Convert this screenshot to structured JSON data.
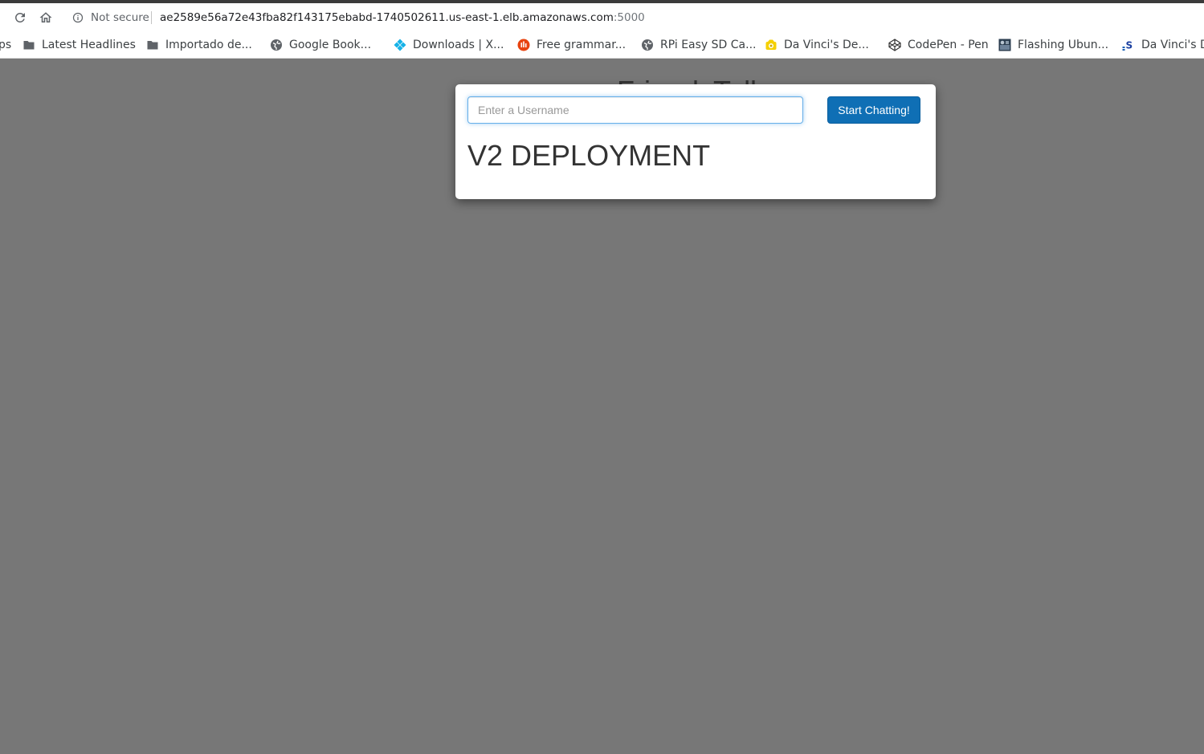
{
  "browser": {
    "security_label": "Not secure",
    "url_host": "ae2589e56a72e43fba82f143175ebabd-1740502611.us-east-1.elb.amazonaws.com",
    "url_port": ":5000"
  },
  "bookmarks": {
    "items": [
      {
        "label": "ps",
        "icon": "none"
      },
      {
        "label": "Latest Headlines",
        "icon": "folder-icon"
      },
      {
        "label": "Importado de...",
        "icon": "folder-icon"
      },
      {
        "label": "Google Book...",
        "icon": "globe-icon"
      },
      {
        "label": "Downloads | X...",
        "icon": "kodi-icon"
      },
      {
        "label": "Free grammar...",
        "icon": "grammar-site-icon"
      },
      {
        "label": "RPi Easy SD Ca...",
        "icon": "globe-icon"
      },
      {
        "label": "Da Vinci's De...",
        "icon": "davinci-icon"
      },
      {
        "label": "CodePen - Pen",
        "icon": "codepen-icon"
      },
      {
        "label": "Flashing Ubun...",
        "icon": "ubuntu-image-icon"
      },
      {
        "label": "Da Vinci's D",
        "icon": "s-site-icon"
      }
    ]
  },
  "page": {
    "title_behind": "FriendsTalk",
    "username_placeholder": "Enter a Username",
    "start_button": "Start Chatting!",
    "heading": "V2 DEPLOYMENT"
  },
  "colors": {
    "page_background": "#777777",
    "button_blue": "#0f6fb5",
    "focus_blue": "#66afe9"
  }
}
